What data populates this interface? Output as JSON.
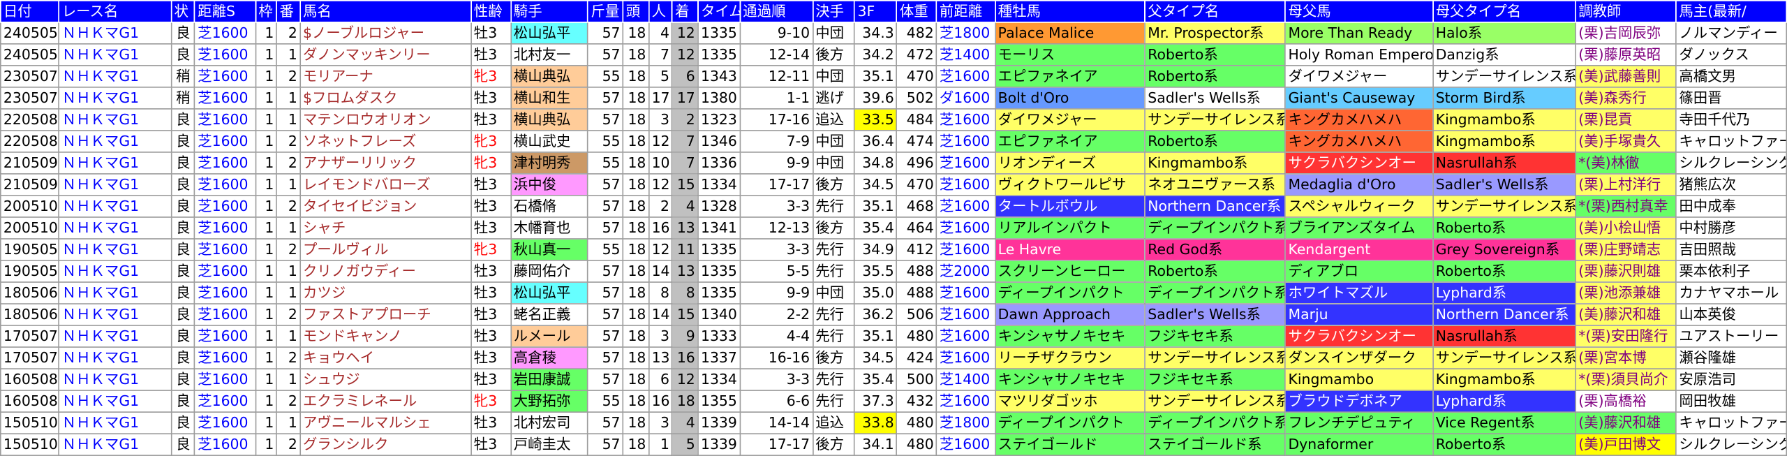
{
  "colors": {
    "header_bg": "#0000ff",
    "header_text": "#ffffff",
    "race_text": "#0000ff",
    "horse_text": "#a52a2a",
    "trainer_text": "#800080",
    "mare_text": "#ff0000",
    "rank_bg": "#c0c0c0",
    "top_3f_bg": "#ffff00"
  },
  "headers": [
    "日付",
    "レース名",
    "状",
    "距離S",
    "枠",
    "番",
    "馬名",
    "性齢",
    "騎手",
    "斤量",
    "頭",
    "人",
    "着",
    "タイム",
    "通過順",
    "決手",
    "3F",
    "体重",
    "前距離",
    "種牡馬",
    "父タイプ名",
    "母父馬",
    "母父タイプ名",
    "調教師",
    "馬主(最新/"
  ],
  "rows": [
    {
      "date": "240505",
      "race": "ＮＨＫマG1",
      "cond": "良",
      "dist": "芝1600",
      "waku": "1",
      "ban": "2",
      "horse": "$ノーブルロジャー",
      "sex": "牡3",
      "jockey": "松山弘平",
      "jbg": "#66ffff",
      "kin": "57",
      "tou": "18",
      "nin": "4",
      "chaku": "12",
      "time": "1335",
      "pass": "9-10",
      "kete": "中団",
      "f3": "34.3",
      "f3bg": "",
      "wt": "482",
      "prev": "芝1800",
      "sire": "Palace Malice",
      "sbg": "#ff9933",
      "sfcol": "#000000",
      "stype": "Mr. Prospector系",
      "stbg": "#ffff66",
      "dam": "More Than Ready",
      "dbg": "#99ff66",
      "dtype": "Halo系",
      "dtbg": "#99ff66",
      "trainer": "(栗)吉岡辰弥",
      "tbg": "#ffffff",
      "owner": "ノルマンディー"
    },
    {
      "date": "240505",
      "race": "ＮＨＫマG1",
      "cond": "良",
      "dist": "芝1600",
      "waku": "1",
      "ban": "1",
      "horse": "ダノンマッキンリー",
      "sex": "牡3",
      "jockey": "北村友一",
      "jbg": "#ffffff",
      "kin": "57",
      "tou": "18",
      "nin": "7",
      "chaku": "12",
      "time": "1335",
      "pass": "12-14",
      "kete": "後方",
      "f3": "34.2",
      "f3bg": "",
      "wt": "472",
      "prev": "芝1400",
      "sire": "モーリス",
      "sbg": "#66ff66",
      "sfcol": "#000000",
      "stype": "Roberto系",
      "stbg": "#66ff66",
      "dam": "Holy Roman Emperor",
      "dbg": "#ffffff",
      "dtype": "Danzig系",
      "dtbg": "#ffffff",
      "trainer": "(栗)藤原英昭",
      "tbg": "#ffffff",
      "owner": "ダノックス"
    },
    {
      "date": "230507",
      "race": "ＮＨＫマG1",
      "cond": "稍",
      "dist": "芝1600",
      "waku": "1",
      "ban": "2",
      "horse": "モリアーナ",
      "sex": "牝3",
      "jockey": "横山典弘",
      "jbg": "#ffcc99",
      "kin": "55",
      "tou": "18",
      "nin": "5",
      "chaku": "6",
      "time": "1343",
      "pass": "12-11",
      "kete": "中団",
      "f3": "35.1",
      "f3bg": "",
      "wt": "470",
      "prev": "芝1600",
      "sire": "エピファネイア",
      "sbg": "#66ff66",
      "sfcol": "#000000",
      "stype": "Roberto系",
      "stbg": "#66ff66",
      "dam": "ダイワメジャー",
      "dbg": "#ffffff",
      "dtype": "サンデーサイレンス系",
      "dtbg": "#ffffff",
      "trainer": "(美)武藤善則",
      "tbg": "#ffff66",
      "owner": "高橋文男"
    },
    {
      "date": "230507",
      "race": "ＮＨＫマG1",
      "cond": "稍",
      "dist": "芝1600",
      "waku": "1",
      "ban": "1",
      "horse": "$フロムダスク",
      "sex": "牡3",
      "jockey": "横山和生",
      "jbg": "#ffcc99",
      "kin": "57",
      "tou": "18",
      "nin": "17",
      "chaku": "17",
      "time": "1380",
      "pass": "1-1",
      "kete": "逃げ",
      "f3": "39.6",
      "f3bg": "",
      "wt": "502",
      "prev": "ダ1600",
      "sire": "Bolt d'Oro",
      "sbg": "#6699ff",
      "sfcol": "#000000",
      "stype": "Sadler's Wells系",
      "stbg": "#ffffff",
      "dam": "Giant's Causeway",
      "dbg": "#66ccff",
      "dtype": "Storm Bird系",
      "dtbg": "#66ccff",
      "trainer": "(美)森秀行",
      "tbg": "#ffff66",
      "owner": "篠田晋"
    },
    {
      "date": "220508",
      "race": "ＮＨＫマG1",
      "cond": "良",
      "dist": "芝1600",
      "waku": "1",
      "ban": "1",
      "horse": "マテンロウオリオン",
      "sex": "牡3",
      "jockey": "横山典弘",
      "jbg": "#ffcc99",
      "kin": "57",
      "tou": "18",
      "nin": "3",
      "chaku": "2",
      "time": "1323",
      "pass": "17-16",
      "kete": "追込",
      "f3": "33.5",
      "f3bg": "#ffff00",
      "wt": "484",
      "prev": "芝1600",
      "sire": "ダイワメジャー",
      "sbg": "#ffff66",
      "sfcol": "#000000",
      "stype": "サンデーサイレンス系",
      "stbg": "#ffff66",
      "dam": "キングカメハメハ",
      "dbg": "#ff6633",
      "dtype": "Kingmambo系",
      "dtbg": "#ffff66",
      "trainer": "(栗)昆貢",
      "tbg": "#ffff66",
      "owner": "寺田千代乃"
    },
    {
      "date": "220508",
      "race": "ＮＨＫマG1",
      "cond": "良",
      "dist": "芝1600",
      "waku": "1",
      "ban": "2",
      "horse": "ソネットフレーズ",
      "sex": "牝3",
      "jockey": "横山武史",
      "jbg": "#ffffff",
      "kin": "55",
      "tou": "18",
      "nin": "12",
      "chaku": "7",
      "time": "1346",
      "pass": "7-9",
      "kete": "中団",
      "f3": "36.4",
      "f3bg": "",
      "wt": "474",
      "prev": "芝1600",
      "sire": "エピファネイア",
      "sbg": "#66ff66",
      "sfcol": "#000000",
      "stype": "Roberto系",
      "stbg": "#66ff66",
      "dam": "キングカメハメハ",
      "dbg": "#ff6633",
      "dtype": "Kingmambo系",
      "dtbg": "#ffff66",
      "trainer": "(美)手塚貴久",
      "tbg": "#ffff66",
      "owner": "キャロットファー"
    },
    {
      "date": "210509",
      "race": "ＮＨＫマG1",
      "cond": "良",
      "dist": "芝1600",
      "waku": "1",
      "ban": "2",
      "horse": "アナザーリリック",
      "sex": "牝3",
      "jockey": "津村明秀",
      "jbg": "#cc9966",
      "kin": "55",
      "tou": "18",
      "nin": "10",
      "chaku": "7",
      "time": "1336",
      "pass": "9-9",
      "kete": "中団",
      "f3": "34.8",
      "f3bg": "",
      "wt": "496",
      "prev": "芝1600",
      "sire": "リオンディーズ",
      "sbg": "#ffff66",
      "sfcol": "#000000",
      "stype": "Kingmambo系",
      "stbg": "#ffff66",
      "dam": "サクラバクシンオー",
      "dbg": "#ff3333",
      "dtype": "Nasrullah系",
      "dtbg": "#ff3333",
      "trainer": "*(美)林徹",
      "tbg": "#66ff66",
      "owner": "シルクレーシング"
    },
    {
      "date": "210509",
      "race": "ＮＨＫマG1",
      "cond": "良",
      "dist": "芝1600",
      "waku": "1",
      "ban": "1",
      "horse": "レイモンドバローズ",
      "sex": "牡3",
      "jockey": "浜中俊",
      "jbg": "#ff99ff",
      "kin": "57",
      "tou": "18",
      "nin": "12",
      "chaku": "15",
      "time": "1334",
      "pass": "17-17",
      "kete": "後方",
      "f3": "34.5",
      "f3bg": "",
      "wt": "470",
      "prev": "芝1600",
      "sire": "ヴィクトワールピサ",
      "sbg": "#ffff66",
      "sfcol": "#000000",
      "stype": "ネオユニヴァース系",
      "stbg": "#ffff66",
      "dam": "Medaglia d'Oro",
      "dbg": "#9999ff",
      "dtype": "Sadler's Wells系",
      "dtbg": "#9999ff",
      "trainer": "(栗)上村洋行",
      "tbg": "#ffff66",
      "owner": "猪熊広次"
    },
    {
      "date": "200510",
      "race": "ＮＨＫマG1",
      "cond": "良",
      "dist": "芝1600",
      "waku": "1",
      "ban": "2",
      "horse": "タイセイビジョン",
      "sex": "牡3",
      "jockey": "石橋脩",
      "jbg": "#ffffff",
      "kin": "57",
      "tou": "18",
      "nin": "2",
      "chaku": "4",
      "time": "1328",
      "pass": "3-3",
      "kete": "先行",
      "f3": "35.1",
      "f3bg": "",
      "wt": "468",
      "prev": "芝1600",
      "sire": "タートルボウル",
      "sbg": "#3333ff",
      "sfcol": "#ffffff",
      "stype": "Northern Dancer系",
      "stbg": "#3333ff",
      "dam": "スペシャルウィーク",
      "dbg": "#ffff66",
      "dtype": "サンデーサイレンス系",
      "dtbg": "#ffff66",
      "trainer": "*(栗)西村真幸",
      "tbg": "#66ff66",
      "owner": "田中成奉"
    },
    {
      "date": "200510",
      "race": "ＮＨＫマG1",
      "cond": "良",
      "dist": "芝1600",
      "waku": "1",
      "ban": "1",
      "horse": "シャチ",
      "sex": "牡3",
      "jockey": "木幡育也",
      "jbg": "#ffffff",
      "kin": "57",
      "tou": "18",
      "nin": "16",
      "chaku": "13",
      "time": "1341",
      "pass": "12-13",
      "kete": "後方",
      "f3": "35.4",
      "f3bg": "",
      "wt": "464",
      "prev": "芝1600",
      "sire": "リアルインパクト",
      "sbg": "#66ff66",
      "sfcol": "#000000",
      "stype": "ディープインパクト系",
      "stbg": "#66ff66",
      "dam": "ブライアンズタイム",
      "dbg": "#66ff66",
      "dtype": "Roberto系",
      "dtbg": "#66ff66",
      "trainer": "(美)小桧山悟",
      "tbg": "#ffff66",
      "owner": "中村勝彦"
    },
    {
      "date": "190505",
      "race": "ＮＨＫマG1",
      "cond": "良",
      "dist": "芝1600",
      "waku": "1",
      "ban": "2",
      "horse": "プールヴィル",
      "sex": "牝3",
      "jockey": "秋山真一",
      "jbg": "#66ff66",
      "kin": "55",
      "tou": "18",
      "nin": "12",
      "chaku": "11",
      "time": "1335",
      "pass": "3-3",
      "kete": "先行",
      "f3": "34.9",
      "f3bg": "",
      "wt": "412",
      "prev": "芝1600",
      "sire": "Le Havre",
      "sbg": "#ff3399",
      "sfcol": "#ffffff",
      "stype": "Red God系",
      "stbg": "#ff3399",
      "dam": "Kendargent",
      "dbg": "#ff3399",
      "dtype": "Grey Sovereign系",
      "dtbg": "#ff3399",
      "trainer": "(栗)庄野靖志",
      "tbg": "#ffff66",
      "owner": "吉田照哉"
    },
    {
      "date": "190505",
      "race": "ＮＨＫマG1",
      "cond": "良",
      "dist": "芝1600",
      "waku": "1",
      "ban": "1",
      "horse": "クリノガウディー",
      "sex": "牡3",
      "jockey": "藤岡佑介",
      "jbg": "#ffffff",
      "kin": "57",
      "tou": "18",
      "nin": "14",
      "chaku": "13",
      "time": "1335",
      "pass": "5-5",
      "kete": "先行",
      "f3": "35.5",
      "f3bg": "",
      "wt": "488",
      "prev": "芝2000",
      "sire": "スクリーンヒーロー",
      "sbg": "#66ff66",
      "sfcol": "#000000",
      "stype": "Roberto系",
      "stbg": "#66ff66",
      "dam": "ディアブロ",
      "dbg": "#66ff66",
      "dtype": "Roberto系",
      "dtbg": "#66ff66",
      "trainer": "(栗)藤沢則雄",
      "tbg": "#ffff66",
      "owner": "栗本依利子"
    },
    {
      "date": "180506",
      "race": "ＮＨＫマG1",
      "cond": "良",
      "dist": "芝1600",
      "waku": "1",
      "ban": "1",
      "horse": "カツジ",
      "sex": "牡3",
      "jockey": "松山弘平",
      "jbg": "#66ffff",
      "kin": "57",
      "tou": "18",
      "nin": "8",
      "chaku": "8",
      "time": "1335",
      "pass": "9-9",
      "kete": "中団",
      "f3": "35.0",
      "f3bg": "",
      "wt": "488",
      "prev": "芝1600",
      "sire": "ディープインパクト",
      "sbg": "#66ff66",
      "sfcol": "#000000",
      "stype": "ディープインパクト系",
      "stbg": "#66ff66",
      "dam": "ホワイトマズル",
      "dbg": "#3333ff",
      "dtype": "Lyphard系",
      "dtbg": "#3333ff",
      "trainer": "(栗)池添兼雄",
      "tbg": "#ffff66",
      "owner": "カナヤマホール"
    },
    {
      "date": "180506",
      "race": "ＮＨＫマG1",
      "cond": "良",
      "dist": "芝1600",
      "waku": "1",
      "ban": "2",
      "horse": "ファストアプローチ",
      "sex": "牡3",
      "jockey": "蛯名正義",
      "jbg": "#ffffff",
      "kin": "57",
      "tou": "18",
      "nin": "14",
      "chaku": "15",
      "time": "1340",
      "pass": "2-2",
      "kete": "先行",
      "f3": "36.2",
      "f3bg": "",
      "wt": "506",
      "prev": "芝1600",
      "sire": "Dawn Approach",
      "sbg": "#9999ff",
      "sfcol": "#000000",
      "stype": "Sadler's Wells系",
      "stbg": "#9999ff",
      "dam": "Marju",
      "dbg": "#3333ff",
      "dtype": "Northern Dancer系",
      "dtbg": "#3333ff",
      "trainer": "(美)藤沢和雄",
      "tbg": "#ffff66",
      "owner": "山本英俊"
    },
    {
      "date": "170507",
      "race": "ＮＨＫマG1",
      "cond": "良",
      "dist": "芝1600",
      "waku": "1",
      "ban": "1",
      "horse": "モンドキャンノ",
      "sex": "牡3",
      "jockey": "ルメール",
      "jbg": "#ffcc99",
      "kin": "57",
      "tou": "18",
      "nin": "3",
      "chaku": "9",
      "time": "1333",
      "pass": "4-4",
      "kete": "先行",
      "f3": "35.1",
      "f3bg": "",
      "wt": "480",
      "prev": "芝1600",
      "sire": "キンシャサノキセキ",
      "sbg": "#66ff66",
      "sfcol": "#000000",
      "stype": "フジキセキ系",
      "stbg": "#66ff66",
      "dam": "サクラバクシンオー",
      "dbg": "#ff3333",
      "dtype": "Nasrullah系",
      "dtbg": "#ff3333",
      "trainer": "*(栗)安田隆行",
      "tbg": "#ffff66",
      "owner": "ユアストーリー"
    },
    {
      "date": "170507",
      "race": "ＮＨＫマG1",
      "cond": "良",
      "dist": "芝1600",
      "waku": "1",
      "ban": "2",
      "horse": "キョウヘイ",
      "sex": "牡3",
      "jockey": "高倉稜",
      "jbg": "#ff99ff",
      "kin": "57",
      "tou": "18",
      "nin": "13",
      "chaku": "16",
      "time": "1337",
      "pass": "16-16",
      "kete": "後方",
      "f3": "34.5",
      "f3bg": "",
      "wt": "424",
      "prev": "芝1600",
      "sire": "リーチザクラウン",
      "sbg": "#ffff66",
      "sfcol": "#000000",
      "stype": "サンデーサイレンス系",
      "stbg": "#ffff66",
      "dam": "ダンスインザダーク",
      "dbg": "#ffff66",
      "dtype": "サンデーサイレンス系",
      "dtbg": "#ffff66",
      "trainer": "(栗)宮本博",
      "tbg": "#ffff66",
      "owner": "瀬谷隆雄"
    },
    {
      "date": "160508",
      "race": "ＮＨＫマG1",
      "cond": "良",
      "dist": "芝1600",
      "waku": "1",
      "ban": "1",
      "horse": "シュウジ",
      "sex": "牡3",
      "jockey": "岩田康誠",
      "jbg": "#66ff66",
      "kin": "57",
      "tou": "18",
      "nin": "6",
      "chaku": "12",
      "time": "1334",
      "pass": "3-3",
      "kete": "先行",
      "f3": "35.4",
      "f3bg": "",
      "wt": "500",
      "prev": "芝1400",
      "sire": "キンシャサノキセキ",
      "sbg": "#66ff66",
      "sfcol": "#000000",
      "stype": "フジキセキ系",
      "stbg": "#66ff66",
      "dam": "Kingmambo",
      "dbg": "#ffff66",
      "dtype": "Kingmambo系",
      "dtbg": "#ffff66",
      "trainer": "*(栗)須貝尚介",
      "tbg": "#ffff66",
      "owner": "安原浩司"
    },
    {
      "date": "160508",
      "race": "ＮＨＫマG1",
      "cond": "良",
      "dist": "芝1600",
      "waku": "1",
      "ban": "2",
      "horse": "エクラミレネール",
      "sex": "牝3",
      "jockey": "大野拓弥",
      "jbg": "#66ff66",
      "kin": "55",
      "tou": "18",
      "nin": "16",
      "chaku": "18",
      "time": "1355",
      "pass": "6-6",
      "kete": "先行",
      "f3": "37.3",
      "f3bg": "",
      "wt": "432",
      "prev": "芝1600",
      "sire": "マツリダゴッホ",
      "sbg": "#ffff66",
      "sfcol": "#000000",
      "stype": "サンデーサイレンス系",
      "stbg": "#ffff66",
      "dam": "ブラウドデボネア",
      "dbg": "#3333ff",
      "dtype": "Lyphard系",
      "dtbg": "#3333ff",
      "trainer": "(栗)高橋裕",
      "tbg": "#ffffff",
      "owner": "岡田牧雄"
    },
    {
      "date": "150510",
      "race": "ＮＨＫマG1",
      "cond": "良",
      "dist": "芝1600",
      "waku": "1",
      "ban": "1",
      "horse": "アヴニールマルシェ",
      "sex": "牡3",
      "jockey": "北村宏司",
      "jbg": "#ffffff",
      "kin": "57",
      "tou": "18",
      "nin": "3",
      "chaku": "4",
      "time": "1339",
      "pass": "14-14",
      "kete": "追込",
      "f3": "33.8",
      "f3bg": "#ffff00",
      "wt": "480",
      "prev": "芝1800",
      "sire": "ディープインパクト",
      "sbg": "#66ff66",
      "sfcol": "#000000",
      "stype": "ディープインパクト系",
      "stbg": "#66ff66",
      "dam": "フレンチデピュティ",
      "dbg": "#66ff66",
      "dtype": "Vice Regent系",
      "dtbg": "#66ff66",
      "trainer": "(美)藤沢和雄",
      "tbg": "#66ff66",
      "owner": "キャロットファー"
    },
    {
      "date": "150510",
      "race": "ＮＨＫマG1",
      "cond": "良",
      "dist": "芝1600",
      "waku": "1",
      "ban": "2",
      "horse": "グランシルク",
      "sex": "牡3",
      "jockey": "戸崎圭太",
      "jbg": "#ffffff",
      "kin": "57",
      "tou": "18",
      "nin": "1",
      "chaku": "5",
      "time": "1339",
      "pass": "17-17",
      "kete": "後方",
      "f3": "34.1",
      "f3bg": "",
      "wt": "480",
      "prev": "芝1600",
      "sire": "ステイゴールド",
      "sbg": "#66ff66",
      "sfcol": "#000000",
      "stype": "ステイゴールド系",
      "stbg": "#66ff66",
      "dam": "Dynaformer",
      "dbg": "#66ff66",
      "dtype": "Roberto系",
      "dtbg": "#66ff66",
      "trainer": "(美)戸田博文",
      "tbg": "#ffff00",
      "owner": "シルクレーシング"
    }
  ]
}
